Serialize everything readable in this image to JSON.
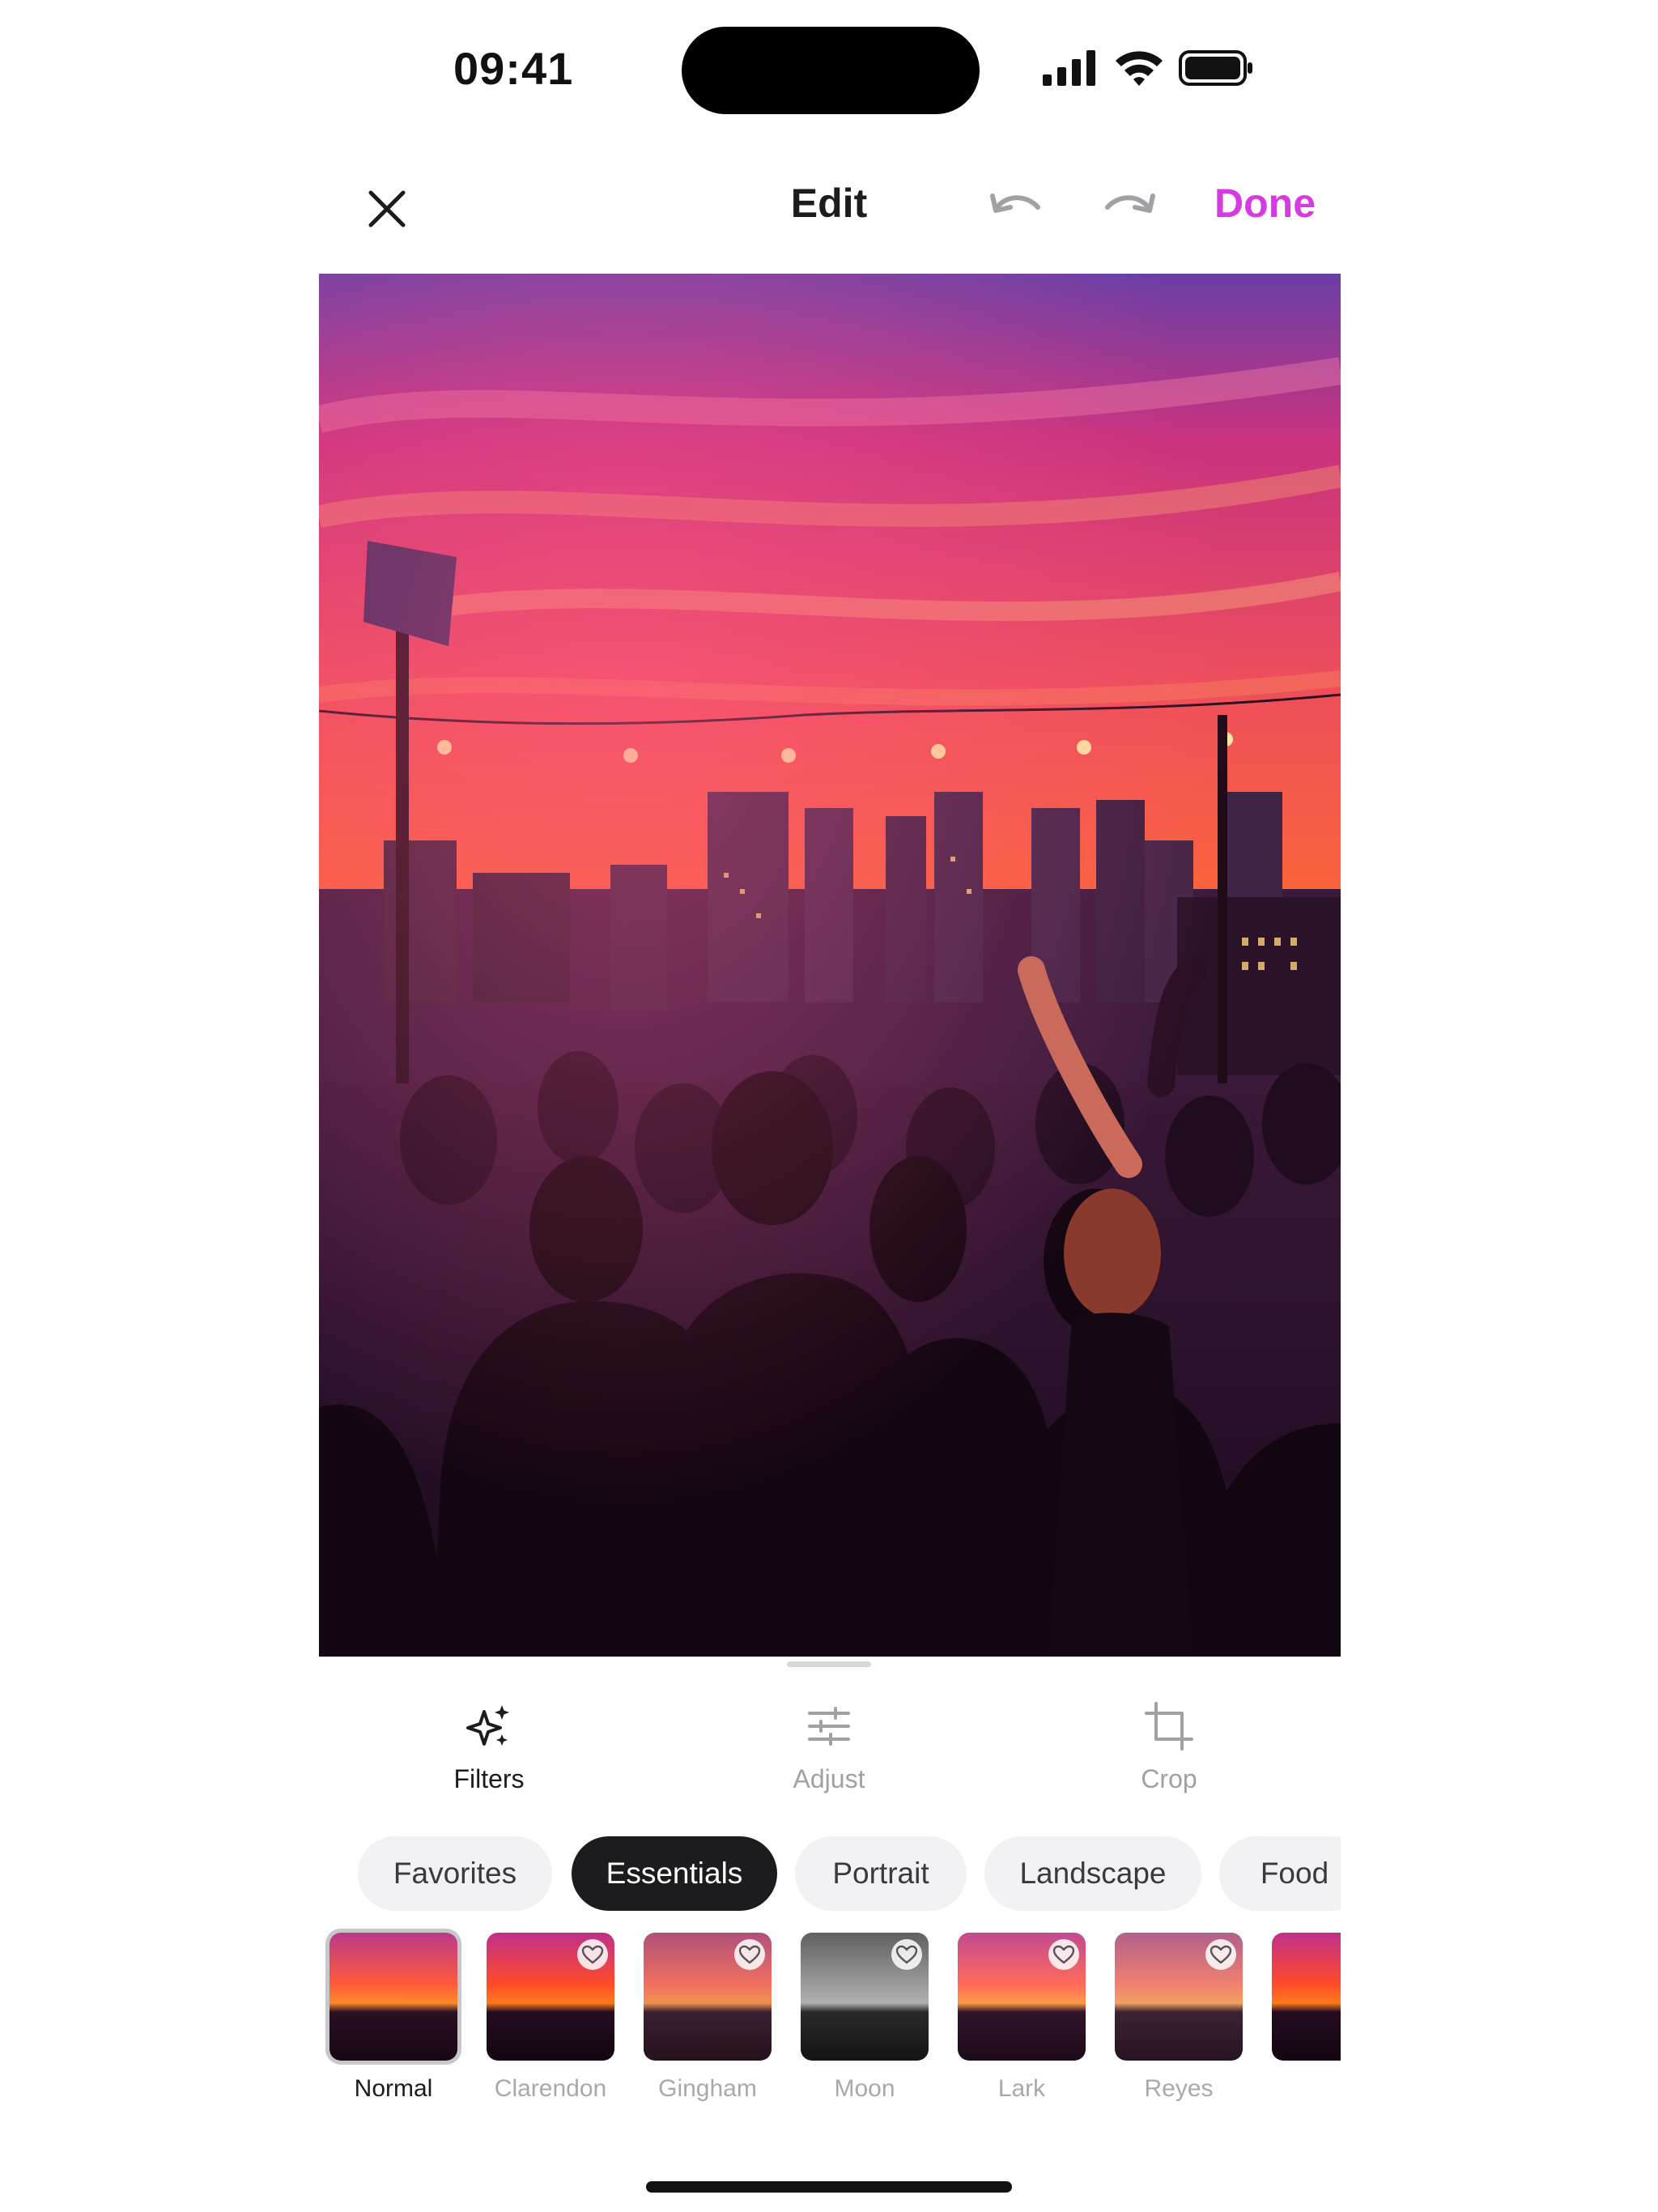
{
  "status_bar": {
    "time": "09:41",
    "icons": [
      "cellular-signal-icon",
      "wifi-icon",
      "battery-icon"
    ]
  },
  "nav": {
    "close_icon": "close-icon",
    "title": "Edit",
    "undo_icon": "undo-icon",
    "redo_icon": "redo-icon",
    "done_label": "Done",
    "accent_color": "#d53be0"
  },
  "tools": [
    {
      "label": "Filters",
      "icon": "sparkles-icon",
      "active": true
    },
    {
      "label": "Adjust",
      "icon": "sliders-icon",
      "active": false
    },
    {
      "label": "Crop",
      "icon": "crop-icon",
      "active": false
    }
  ],
  "categories": [
    {
      "label": "Favorites",
      "active": false
    },
    {
      "label": "Essentials",
      "active": true
    },
    {
      "label": "Portrait",
      "active": false
    },
    {
      "label": "Landscape",
      "active": false
    },
    {
      "label": "Food",
      "active": false
    }
  ],
  "filters": [
    {
      "name": "Normal",
      "selected": true,
      "favorite_icon": false
    },
    {
      "name": "Clarendon",
      "selected": false,
      "favorite_icon": true
    },
    {
      "name": "Gingham",
      "selected": false,
      "favorite_icon": true
    },
    {
      "name": "Moon",
      "selected": false,
      "favorite_icon": true
    },
    {
      "name": "Lark",
      "selected": false,
      "favorite_icon": true
    },
    {
      "name": "Reyes",
      "selected": false,
      "favorite_icon": true
    }
  ]
}
